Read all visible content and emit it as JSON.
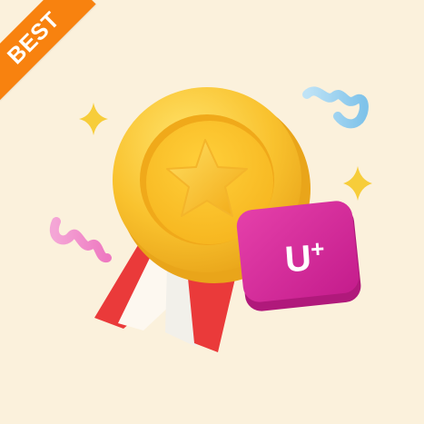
{
  "badge": {
    "label": "BEST",
    "color": "#f8820f"
  },
  "brand_tile": {
    "text": "U",
    "superscript": "+",
    "color": "#d9259a"
  },
  "medal": {
    "icon": "star-icon",
    "color": "#f9c22e"
  },
  "ribbon_colors": {
    "red": "#ea3a3a",
    "white": "#fdf8f0"
  },
  "decorations": [
    "sparkle-icon",
    "sparkle-icon",
    "squiggle-blue",
    "squiggle-pink"
  ]
}
